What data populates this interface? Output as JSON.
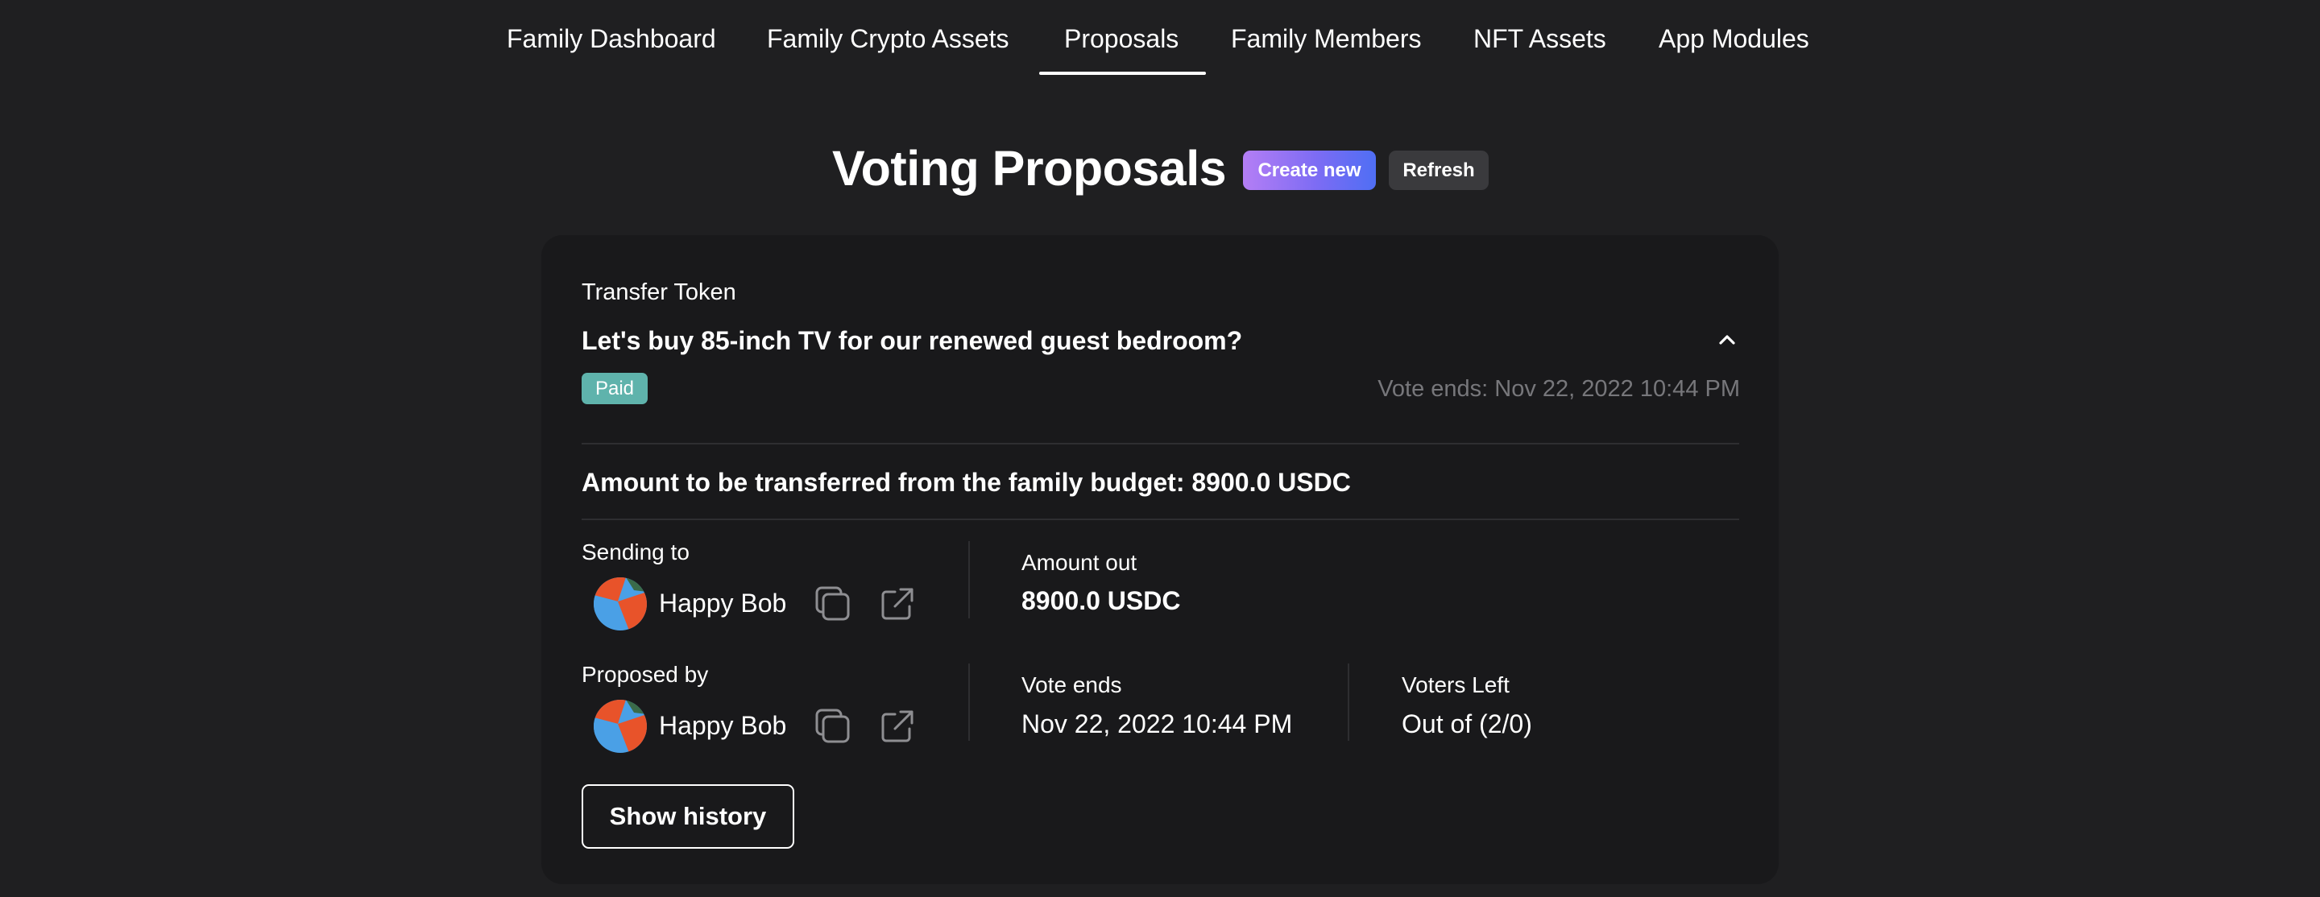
{
  "nav": {
    "tabs": [
      {
        "label": "Family Dashboard"
      },
      {
        "label": "Family Crypto Assets"
      },
      {
        "label": "Proposals"
      },
      {
        "label": "Family Members"
      },
      {
        "label": "NFT Assets"
      },
      {
        "label": "App Modules"
      }
    ],
    "active_tab": "Proposals"
  },
  "header": {
    "title": "Voting Proposals",
    "create_label": "Create new",
    "refresh_label": "Refresh"
  },
  "proposal": {
    "type": "Transfer Token",
    "title": "Let's buy 85-inch TV for our renewed guest bedroom?",
    "status": "Paid",
    "vote_ends_text": "Vote ends: Nov 22, 2022 10:44 PM",
    "amount_line": "Amount to be transferred from the family budget: 8900.0 USDC",
    "sending_to_label": "Sending to",
    "sending_to_name": "Happy Bob",
    "amount_out_label": "Amount out",
    "amount_out_value": "8900.0 USDC",
    "proposed_by_label": "Proposed by",
    "proposed_by_name": "Happy Bob",
    "vote_ends_label": "Vote ends",
    "vote_ends_value": "Nov 22, 2022 10:44 PM",
    "voters_left_label": "Voters Left",
    "voters_left_value": "Out of (2/0)",
    "show_history_label": "Show history"
  },
  "icons": {
    "chevron": "chevron-up-icon",
    "copy": "copy-icon",
    "external": "external-link-icon",
    "avatar": "avatar"
  },
  "colors": {
    "background": "#1f1f21",
    "card": "#19191b",
    "badge": "#5fb3ac",
    "accent_gradient_start": "#b47ef5",
    "accent_gradient_end": "#4f6ef4"
  }
}
